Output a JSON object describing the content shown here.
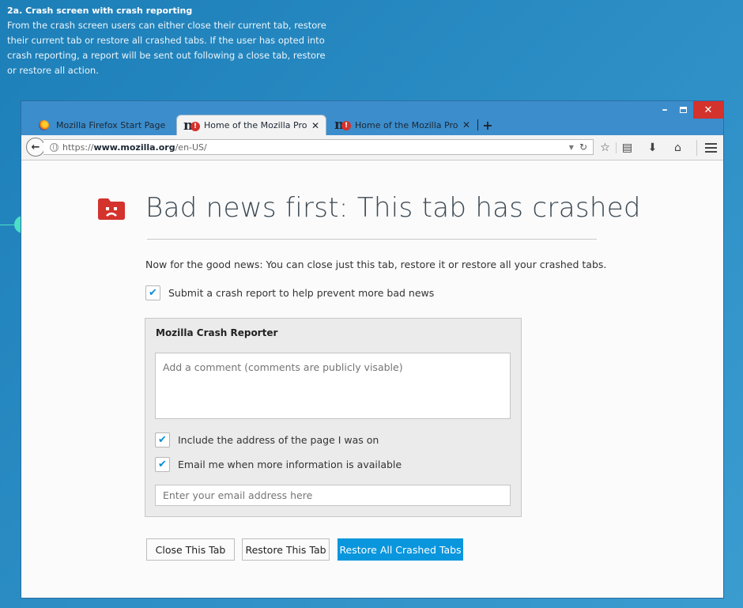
{
  "annotation": {
    "title": "2a. Crash screen with crash reporting",
    "lines": [
      "From the crash screen users can either close their current tab, restore",
      "their current tab or restore all crashed tabs. If the user has opted into",
      "crash reporting, a report will be sent out following a close tab, restore",
      "or restore all action."
    ]
  },
  "window_controls": {
    "minimize": "–",
    "close": "✕"
  },
  "tabs": [
    {
      "label": "Mozilla Firefox Start Page",
      "icon": "firefox-icon",
      "active": false
    },
    {
      "label": "Home of the Mozilla Proje...",
      "icon": "mozilla-crashed-icon",
      "active": true
    },
    {
      "label": "Home of the Mozilla Proje...",
      "icon": "mozilla-crashed-icon",
      "active": false
    }
  ],
  "tab_close": "✕",
  "new_tab": "+",
  "toolbar": {
    "url_prefix": "https://",
    "url_domain": "www.mozilla.org",
    "url_path": "/en-US/",
    "icons": [
      "star-icon",
      "reading-list-icon",
      "download-icon",
      "home-icon",
      "menu-icon"
    ]
  },
  "crash_page": {
    "title": "Bad news first: This tab has crashed",
    "good_news": "Now for the good news: You can close just this tab, restore it or restore all your crashed tabs.",
    "submit_report_label": "Submit a crash report to help prevent more bad news",
    "submit_report_checked": true,
    "reporter": {
      "title": "Mozilla Crash Reporter",
      "comment_placeholder": "Add a comment (comments are publicly visable)",
      "include_address_label": "Include the address of the page I was on",
      "include_address_checked": true,
      "email_me_label": "Email me when more information is available",
      "email_me_checked": true,
      "email_placeholder": "Enter your email address here"
    },
    "buttons": {
      "close_tab": "Close This Tab",
      "restore_tab": "Restore This Tab",
      "restore_all": "Restore All Crashed Tabs"
    }
  },
  "colors": {
    "background": "#2b8cc4",
    "accent": "#0996dd",
    "crash_icon": "#d4322c",
    "connector": "#49e0c6"
  }
}
